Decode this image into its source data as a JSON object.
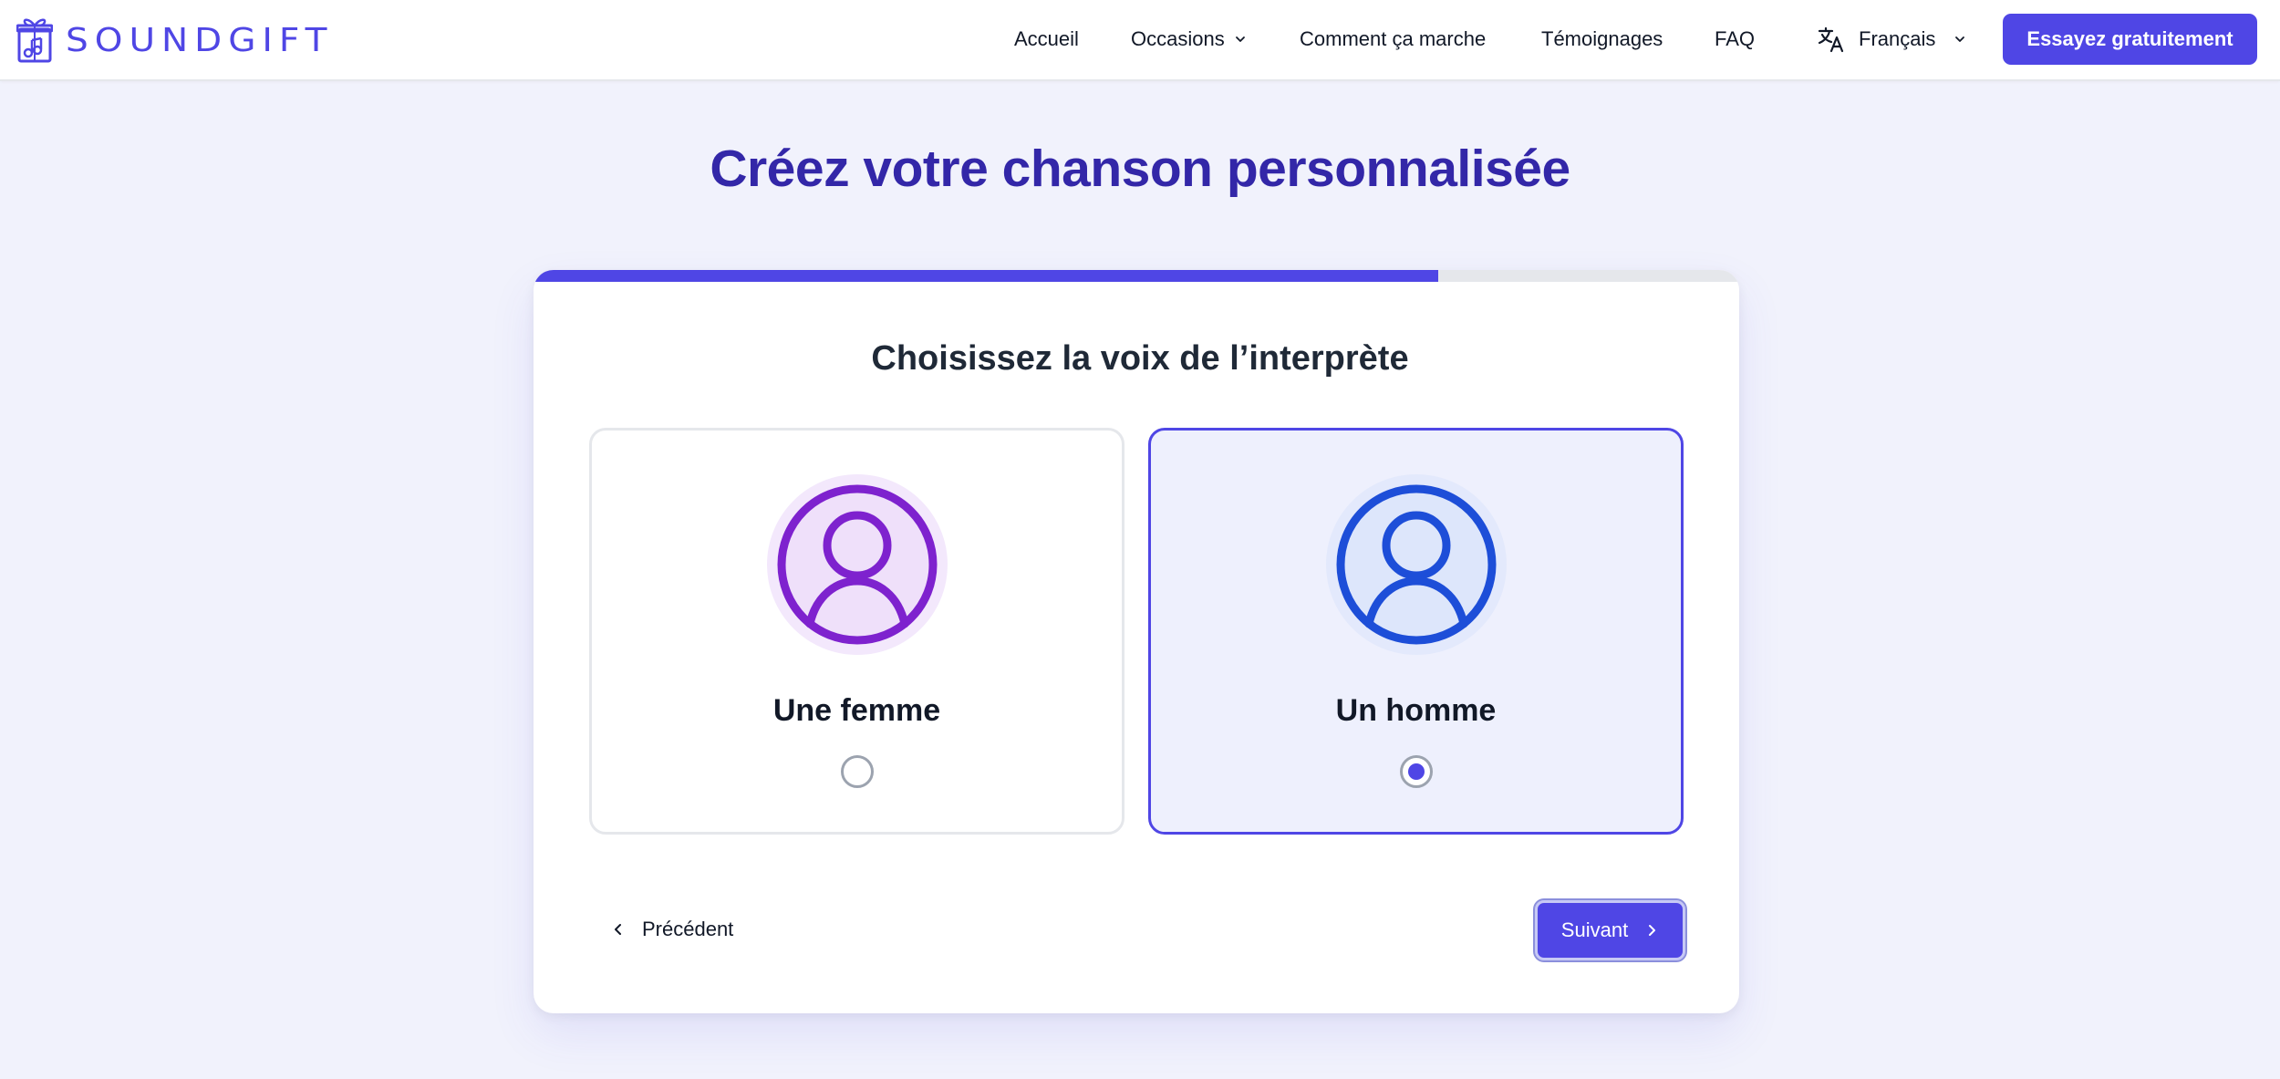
{
  "brand": {
    "name": "SOUNDGIFT",
    "accent": "#4f46e5",
    "title_color": "#3327a8"
  },
  "nav": {
    "items": [
      {
        "label": "Accueil",
        "has_dropdown": false
      },
      {
        "label": "Occasions",
        "has_dropdown": true
      },
      {
        "label": "Comment ça marche",
        "has_dropdown": false
      },
      {
        "label": "Témoignages",
        "has_dropdown": false
      },
      {
        "label": "FAQ",
        "has_dropdown": false
      }
    ],
    "language": {
      "label": "Français",
      "icon": "translate-icon"
    },
    "cta_label": "Essayez gratuitement"
  },
  "page": {
    "title": "Créez votre chanson personnalisée"
  },
  "form": {
    "progress": 0.75,
    "question": "Choisissez la voix de l’interprète",
    "options": [
      {
        "label": "Une femme",
        "icon": "female-avatar-icon",
        "color": "#7e22ce",
        "selected": false
      },
      {
        "label": "Un homme",
        "icon": "male-avatar-icon",
        "color": "#1d4ed8",
        "selected": true
      }
    ],
    "prev_label": "Précédent",
    "next_label": "Suivant"
  }
}
